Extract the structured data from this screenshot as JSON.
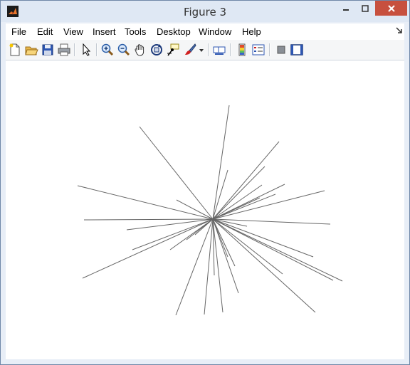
{
  "window": {
    "title": "Figure 3",
    "colors": {
      "titlebar": "#dfe8f4",
      "close": "#c7503e",
      "plot_line": "#666666"
    }
  },
  "titlebar_icons": [
    "matlab-logo-icon",
    "minimize-icon",
    "maximize-icon",
    "close-icon"
  ],
  "menubar": {
    "items": [
      "File",
      "Edit",
      "View",
      "Insert",
      "Tools",
      "Desktop",
      "Window",
      "Help"
    ],
    "dock_icon": "dock-arrow-icon"
  },
  "toolbar": {
    "buttons": [
      "new-figure-icon",
      "open-file-icon",
      "save-figure-icon",
      "print-figure-icon",
      "edit-plot-icon",
      "zoom-in-icon",
      "zoom-out-icon",
      "pan-icon",
      "rotate-3d-icon",
      "data-cursor-icon",
      "brush-icon",
      "brush-dropdown-icon",
      "link-plot-icon",
      "insert-colorbar-icon",
      "insert-legend-icon",
      "hide-plot-tools-icon",
      "show-plot-tools-icon"
    ]
  },
  "plot": {
    "description": "radial line segments emanating from a common center point",
    "line_color": "#666666"
  }
}
